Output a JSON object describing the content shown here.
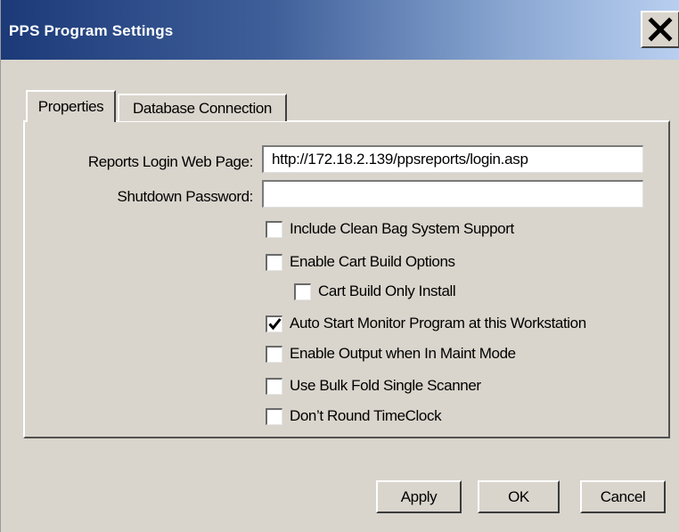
{
  "window": {
    "title": "PPS Program Settings"
  },
  "tabs": [
    {
      "label": "Properties",
      "selected": true
    },
    {
      "label": "Database Connection",
      "selected": false
    }
  ],
  "fields": {
    "reports_login": {
      "label": "Reports Login Web Page:",
      "value": "http://172.18.2.139/ppsreports/login.asp"
    },
    "shutdown_password": {
      "label": "Shutdown Password:",
      "value": ""
    }
  },
  "checkboxes": [
    {
      "label": "Include Clean Bag System Support",
      "checked": false
    },
    {
      "label": "Enable Cart Build Options",
      "checked": false
    },
    {
      "label": "Cart Build Only Install",
      "checked": false
    },
    {
      "label": "Auto Start Monitor Program at this Workstation",
      "checked": true
    },
    {
      "label": "Enable Output when In Maint Mode",
      "checked": false
    },
    {
      "label": "Use Bulk Fold Single Scanner",
      "checked": false
    },
    {
      "label": "Don’t Round TimeClock",
      "checked": false
    }
  ],
  "buttons": {
    "apply": "Apply",
    "ok": "OK",
    "cancel": "Cancel"
  },
  "icons": {
    "close": "close-x-icon",
    "check": "checkmark-icon"
  }
}
